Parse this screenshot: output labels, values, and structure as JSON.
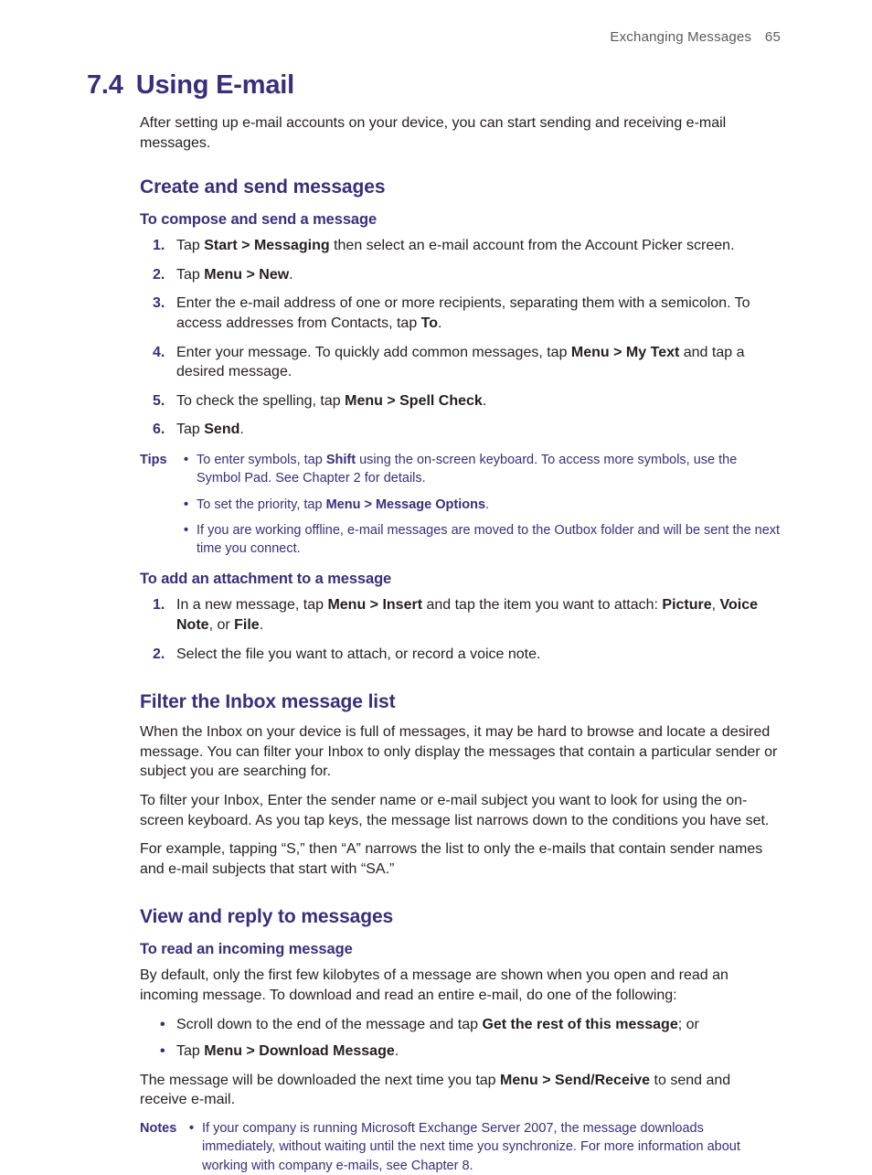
{
  "header": {
    "chapter": "Exchanging Messages",
    "page": "65"
  },
  "h1": {
    "num": "7.4",
    "title": "Using E-mail"
  },
  "intro": "After setting up e-mail accounts on your device, you can start sending and receiving e-mail messages.",
  "sec1": {
    "heading": "Create and send messages",
    "task1": {
      "heading": "To compose and send a message",
      "steps": [
        {
          "pre": "Tap ",
          "b1": "Start > Messaging",
          "post": " then select an e-mail account from the Account Picker screen."
        },
        {
          "pre": "Tap ",
          "b1": "Menu > New",
          "post": "."
        },
        {
          "pre": "Enter the e-mail address of one or more recipients, separating them with a semicolon. To access addresses from Contacts, tap ",
          "b1": "To",
          "post": "."
        },
        {
          "pre": "Enter your message. To quickly add common messages, tap ",
          "b1": "Menu > My Text",
          "post": " and tap a desired message."
        },
        {
          "pre": "To check the spelling, tap ",
          "b1": "Menu > Spell Check",
          "post": "."
        },
        {
          "pre": "Tap ",
          "b1": "Send",
          "post": "."
        }
      ]
    },
    "tips": {
      "label": "Tips",
      "items": [
        {
          "pre": "To enter symbols, tap ",
          "b1": "Shift",
          "post": " using the on-screen keyboard. To access more symbols, use the Symbol Pad. See Chapter 2 for details."
        },
        {
          "pre": "To set the priority, tap ",
          "b1": "Menu > Message Options",
          "post": "."
        },
        {
          "pre": "If you are working offline, e-mail messages are moved to the Outbox folder and will be sent the next time you connect.",
          "b1": "",
          "post": ""
        }
      ]
    },
    "task2": {
      "heading": "To add an attachment to a message",
      "step1": {
        "pre": "In a new message, tap ",
        "b1": "Menu > Insert",
        "mid": " and tap the item you want to attach: ",
        "b2": "Picture",
        "sep1": ", ",
        "b3": "Voice Note",
        "sep2": ", or ",
        "b4": "File",
        "post": "."
      },
      "step2": "Select the file you want to attach, or record a voice note."
    }
  },
  "sec2": {
    "heading": "Filter the Inbox message list",
    "p1": "When the Inbox on your device is full of messages, it may be hard to browse and locate a desired message. You can filter your Inbox to only display the messages that contain a particular sender or subject you are searching for.",
    "p2": "To filter your Inbox, Enter the sender name or e-mail subject you want to look for using the on-screen keyboard. As you tap keys, the message list narrows down to the conditions you have set.",
    "p3": "For example, tapping “S,” then “A” narrows the list to only the e-mails that contain sender names and e-mail subjects that start with “SA.”"
  },
  "sec3": {
    "heading": "View and reply to messages",
    "task1": {
      "heading": "To read an incoming message",
      "p1": "By default, only the first few kilobytes of a message are shown when you open and read an incoming message. To download and read an entire e-mail, do one of the following:",
      "bullets": [
        {
          "pre": "Scroll down to the end of the message and tap ",
          "b1": "Get the rest of this message",
          "post": "; or"
        },
        {
          "pre": "Tap ",
          "b1": "Menu > Download Message",
          "post": "."
        }
      ],
      "p2": {
        "pre": "The message will be downloaded the next time you tap ",
        "b1": "Menu > Send/Receive",
        "post": " to send and receive e-mail."
      }
    },
    "notes": {
      "label": "Notes",
      "items": [
        {
          "pre": "If your company is running Microsoft Exchange Server 2007, the message downloads immediately, without waiting until the next time you synchronize. For more information about working with company e-mails, see Chapter 8.",
          "b1": "",
          "post": ""
        }
      ]
    }
  }
}
